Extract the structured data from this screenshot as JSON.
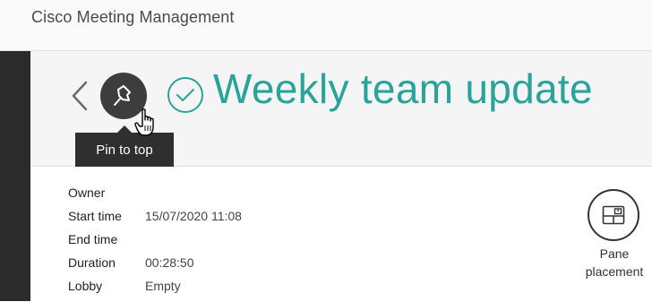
{
  "app": {
    "title": "Cisco Meeting Management"
  },
  "meeting": {
    "title": "Weekly team update",
    "status_icon": "check-circle-icon"
  },
  "toolbar": {
    "back_icon": "chevron-left-icon",
    "pin_icon": "pin-icon"
  },
  "tooltip": {
    "text": "Pin to top"
  },
  "details": {
    "rows": [
      {
        "label": "Owner",
        "value": ""
      },
      {
        "label": "Start time",
        "value": "15/07/2020 11:08"
      },
      {
        "label": "End time",
        "value": ""
      },
      {
        "label": "Duration",
        "value": "00:28:50"
      },
      {
        "label": "Lobby",
        "value": "Empty"
      }
    ]
  },
  "actions": {
    "pane_placement": {
      "label_line1": "Pane",
      "label_line2": "placement",
      "icon": "layout-icon"
    }
  },
  "colors": {
    "accent": "#2aa39a",
    "dark_button": "#3d3d3d",
    "rail": "#2b2b2b"
  }
}
